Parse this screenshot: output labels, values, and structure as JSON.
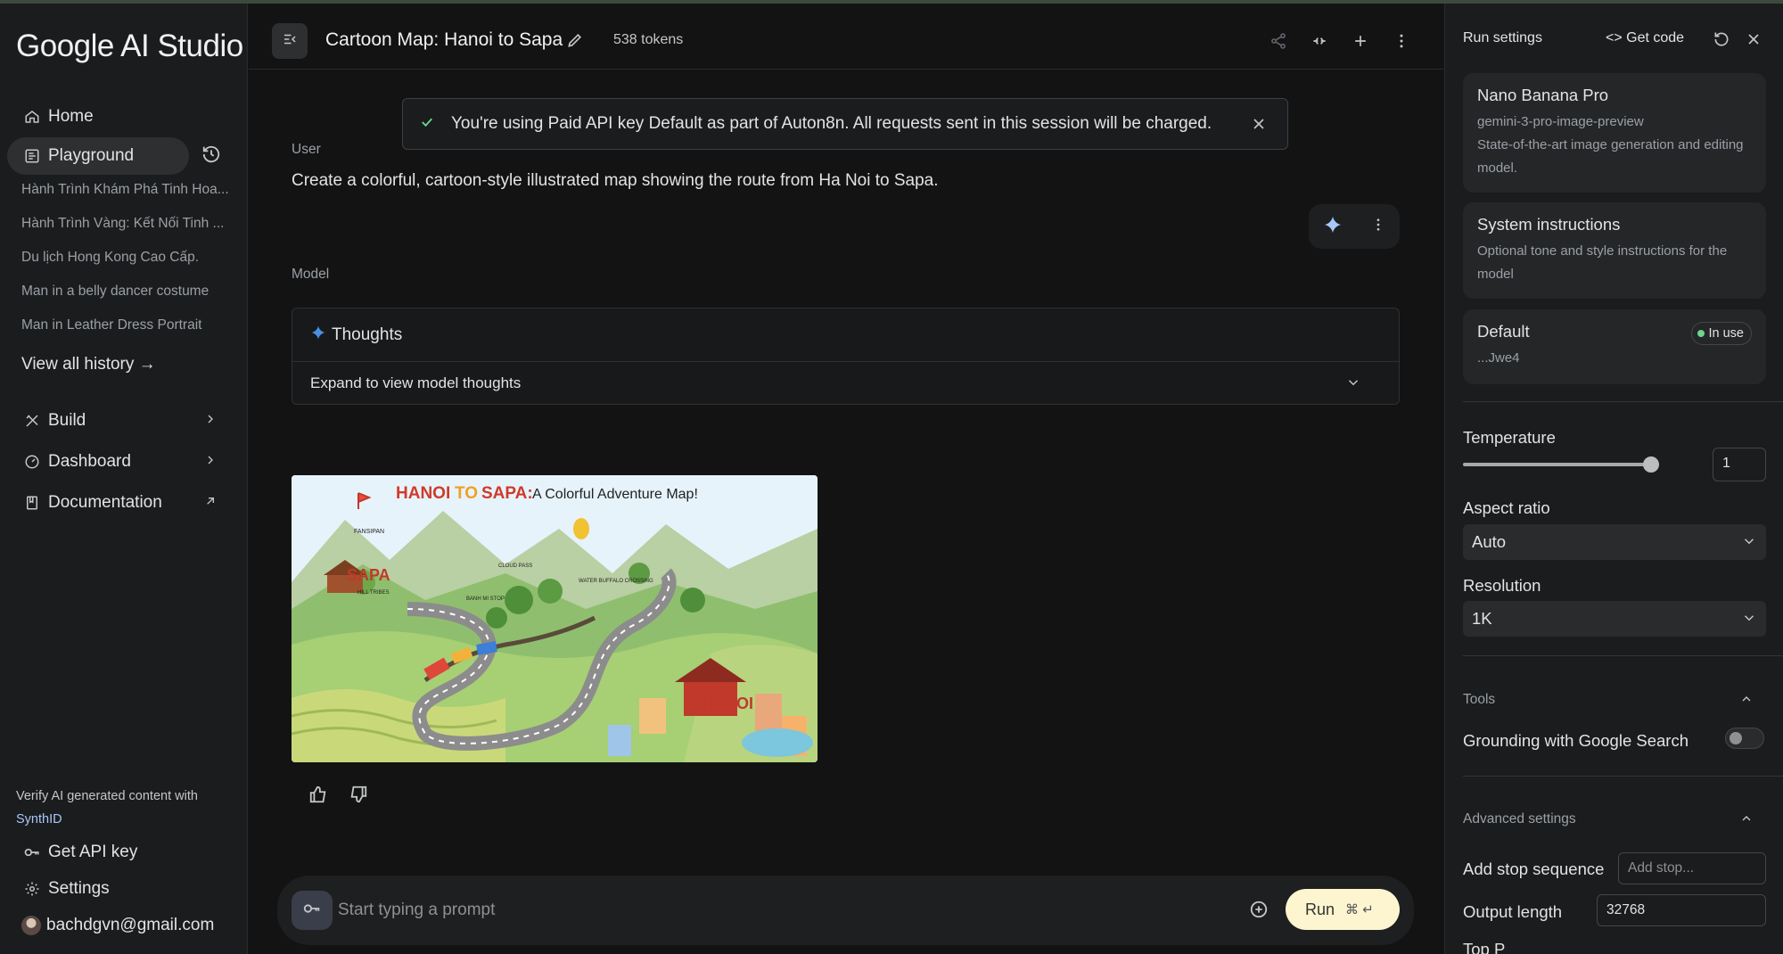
{
  "app": {
    "logo": "Google AI Studio"
  },
  "sidebar": {
    "home": "Home",
    "playground": "Playground",
    "history": [
      "Hành Trình Khám Phá Tinh Hoa...",
      "Hành Trình Vàng: Kết Nối Tinh ...",
      "Du lịch Hong Kong Cao Cấp.",
      "Man in a belly dancer costume",
      "Man in Leather Dress Portrait"
    ],
    "view_all": "View all history →",
    "build": "Build",
    "dashboard": "Dashboard",
    "documentation": "Documentation",
    "verify_text": "Verify AI generated content with",
    "synthid": "SynthID",
    "get_api_key": "Get API key",
    "settings": "Settings",
    "user_email": "bachdgvn@gmail.com"
  },
  "header": {
    "title": "Cartoon Map: Hanoi to Sapa",
    "tokens": "538 tokens"
  },
  "notice": {
    "text": "You're using Paid API key Default as part of Auton8n. All requests sent in this session will be charged."
  },
  "chat": {
    "user_label": "User",
    "user_prompt": "Create a colorful, cartoon-style illustrated map showing the route from Ha Noi to Sapa.",
    "model_label": "Model",
    "thoughts_title": "Thoughts",
    "thoughts_expand": "Expand to view model thoughts",
    "image": {
      "title_hanoi": "HANOI",
      "title_to": "TO",
      "title_sapa": "SAPA:",
      "title_rest": "A Colorful Adventure Map!",
      "labels": {
        "fansipan": "FANSIPAN",
        "sapa": "SAPA",
        "hill_tribes": "HILL TRIBES",
        "banh_mi": "BANH MI STOP",
        "cloud_pass": "CLOUD PASS",
        "water_buffalo": "WATER BUFFALO CROSSING",
        "hanoi": "HANOI"
      }
    }
  },
  "input": {
    "placeholder": "Start typing a prompt",
    "run_label": "Run",
    "run_shortcut": "⌘ ↵"
  },
  "run_settings": {
    "title": "Run settings",
    "get_code": "Get code",
    "model": {
      "name": "Nano Banana Pro",
      "id": "gemini-3-pro-image-preview",
      "description": "State-of-the-art image generation and editing model."
    },
    "system_instructions": {
      "title": "System instructions",
      "description": "Optional tone and style instructions for the model"
    },
    "api_key": {
      "name": "Default",
      "status": "In use",
      "suffix": "...Jwe4"
    },
    "temperature": {
      "label": "Temperature",
      "value": "1",
      "fraction": 1.0
    },
    "aspect_ratio": {
      "label": "Aspect ratio",
      "value": "Auto"
    },
    "resolution": {
      "label": "Resolution",
      "value": "1K"
    },
    "tools": {
      "label": "Tools",
      "grounding": "Grounding with Google Search",
      "grounding_on": false
    },
    "advanced": {
      "label": "Advanced settings",
      "stop_sequence_label": "Add stop sequence",
      "stop_sequence_placeholder": "Add stop...",
      "output_length_label": "Output length",
      "output_length_value": "32768",
      "top_p_label": "Top P"
    }
  },
  "colors": {
    "background": "#131314",
    "panel": "#1b1c1d",
    "accent_run": "#fdf5d0",
    "in_use_dot": "#6dd58c",
    "link": "#a8c7fa"
  }
}
